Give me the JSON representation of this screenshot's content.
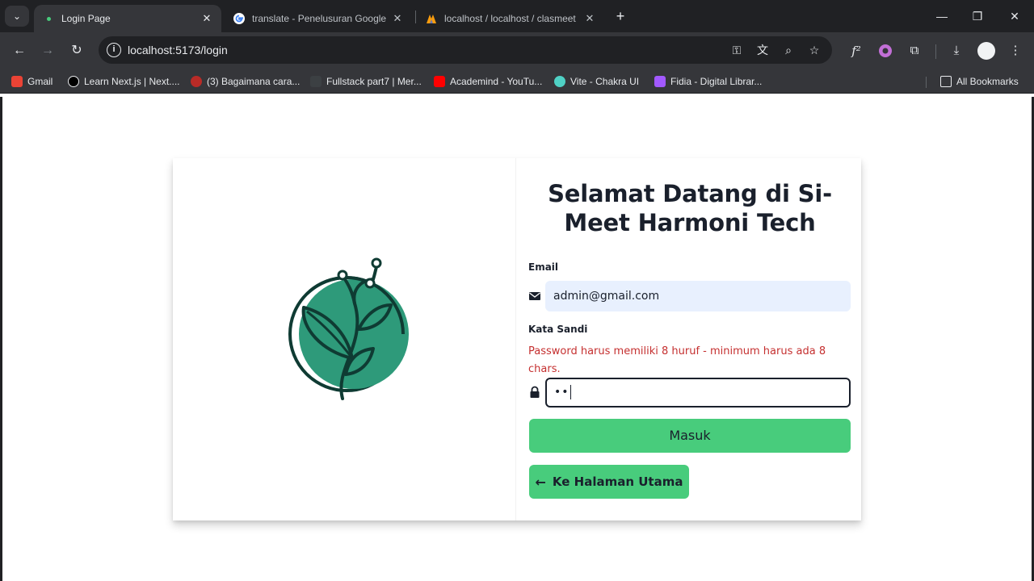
{
  "browser": {
    "tabs": [
      {
        "title": "Login Page",
        "active": true
      },
      {
        "title": "translate - Penelusuran Google",
        "active": false
      },
      {
        "title": "localhost / localhost / clasmeet",
        "active": false
      }
    ],
    "address": "localhost:5173/login",
    "bookmarks": [
      {
        "label": "Gmail",
        "color": "#ea4335"
      },
      {
        "label": "Learn Next.js | Next....",
        "color": "#000000"
      },
      {
        "label": "(3) Bagaimana cara...",
        "color": "#b92b27"
      },
      {
        "label": "Fullstack part7 | Mer...",
        "color": "#3c4043"
      },
      {
        "label": "Academind - YouTu...",
        "color": "#ff0000"
      },
      {
        "label": "Vite - Chakra UI",
        "color": "#4fd1c5"
      },
      {
        "label": "Fidia - Digital Librar...",
        "color": "#a259ff"
      }
    ],
    "all_bookmarks": "All Bookmarks"
  },
  "login": {
    "title_line1": "Selamat Datang di Si-",
    "title_line2": "Meet Harmoni Tech",
    "email_label": "Email",
    "email_value": "admin@gmail.com",
    "password_label": "Kata Sandi",
    "password_error": "Password harus memiliki 8 huruf - minimum harus ada 8 chars.",
    "password_value": "••",
    "submit_label": "Masuk",
    "back_label": "Ke Halaman Utama"
  },
  "colors": {
    "accent": "#48cc7c",
    "logo_fill": "#2e9a7a",
    "logo_stroke": "#0f3b33",
    "error": "#c53030"
  }
}
